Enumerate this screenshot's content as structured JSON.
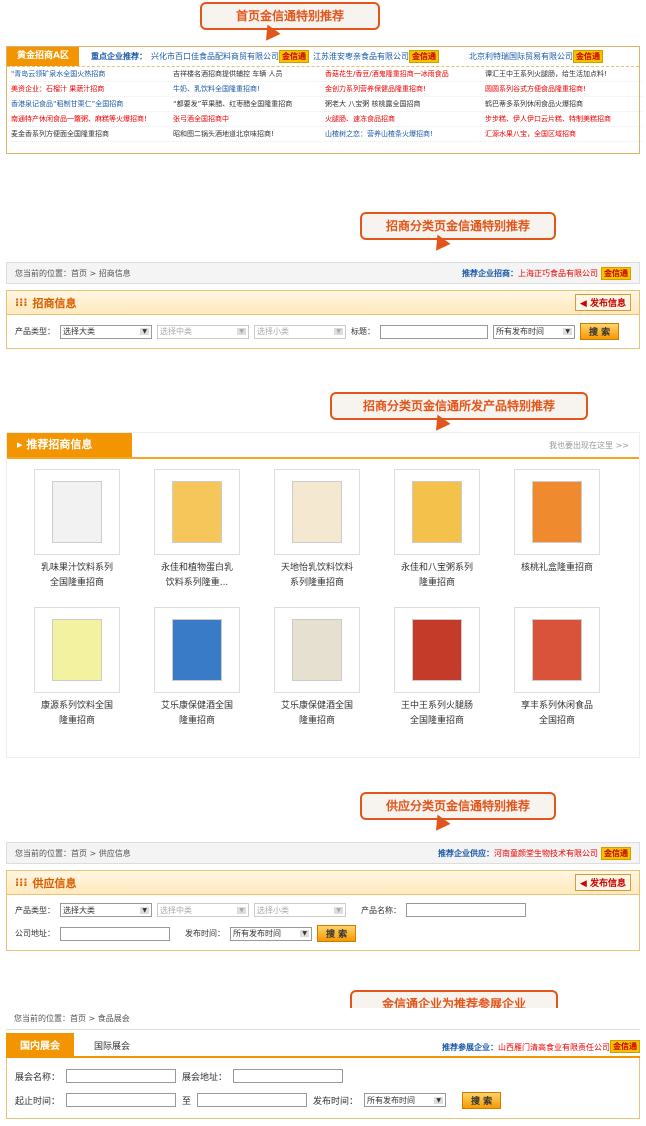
{
  "callouts": {
    "c1": "首页金信通特别推荐",
    "c2": "招商分类页金信通特别推荐",
    "c3": "招商分类页金信通所发产品特别推荐",
    "c4": "供应分类页金信通特别推荐",
    "c5": "金信通企业为推荐参展企业"
  },
  "badge": "金信通",
  "hot": "HOT",
  "home": {
    "tag": "黄金招商A区",
    "key_label": "重点企业推荐：",
    "key_items": [
      "兴化市百口佳食品配料商贸有限公司",
      "江苏淮安枣亲食品有限公司",
      "北京利特瑞国际贸易有限公司"
    ],
    "rows": [
      [
        "\"青岛云领矿泉水全国火热招商",
        "吉祥楼名酒招商提供辅控 车辆 人员",
        "香菇花生/香豆/酒鬼隆重招商一冰雨食品",
        "谭汇王中王系列火腿肠，给生活加点料!"
      ],
      [
        "美资企业：石榴汁 果蔬汁招商",
        "牛奶、乳饮料全国隆重招商!",
        "金创力系列营养保健品隆重招商!",
        "圆圆系列谷式方便食品隆重招商!"
      ],
      [
        "香港泉记食品“稻制甘栗仁”全国招商",
        "“都要发”苹果醋、红枣醋全国隆重招商",
        "粥老大 八宝粥 核桃露全国招商",
        "鹤巴蒂多系列休闲食品火爆招商"
      ],
      [
        "南通特产休闲食品一籮粥、麻糕等火爆招商!",
        "张弓酒全国招商中",
        "火腿肠、速冻食品招商",
        "步步糕、伊人伊口云片糕、特制美糕招商"
      ],
      [
        "麦金香系列方便面全国隆重招商",
        "昭和图二锅头酒地道北京味招商!",
        "山楂树之恋：营养山楂条火爆招商!",
        "汇源水果八宝，全国区域招商"
      ]
    ]
  },
  "zhaoshang": {
    "crumb": "您当前的位置：首页 > 招商信息",
    "rec_label": "推荐企业招商：",
    "rec_company": "上海正巧食品有限公司",
    "title": "招商信息",
    "publish": "发布信息",
    "type_label": "产品类型：",
    "big": "选择大类",
    "mid": "选择中类",
    "small": "选择小类",
    "kw_label": "标题：",
    "time": "所有发布时间",
    "search": "搜 索"
  },
  "recommend": {
    "title": "推荐招商信息",
    "more": "我也要出现在这里 >>",
    "products": [
      [
        "乳味果汁饮料系列",
        "全国隆重招商"
      ],
      [
        "永佳和植物蛋白乳",
        "饮料系列隆重..."
      ],
      [
        "天地怡乳饮料饮料",
        "系列隆重招商"
      ],
      [
        "永佳和八宝粥系列",
        "隆重招商"
      ],
      [
        "核桃礼盒隆重招商",
        ""
      ],
      [
        "康源系列饮料全国",
        "隆重招商"
      ],
      [
        "艾乐康保健酒全国",
        "隆重招商"
      ],
      [
        "艾乐康保健酒全国",
        "隆重招商"
      ],
      [
        "王中王系列火腿肠",
        "全国隆重招商"
      ],
      [
        "享丰系列休闲食品",
        "全国招商"
      ]
    ]
  },
  "gongying": {
    "crumb": "您当前的位置：首页 > 供应信息",
    "rec_label": "推荐企业供应：",
    "rec_company": "河南童颜堂生物技术有限公司",
    "title": "供应信息",
    "publish": "发布信息",
    "type_label": "产品类型：",
    "big": "选择大类",
    "mid": "选择中类",
    "small": "选择小类",
    "name_label": "产品名称：",
    "addr_label": "公司地址：",
    "time_label": "发布时间：",
    "time": "所有发布时间",
    "search": "搜 索"
  },
  "expo": {
    "crumb": "您当前的位置：首页 > 食品展会",
    "tab1": "国内展会",
    "tab2": "国际展会",
    "rec_label": "推荐参展企业：",
    "rec_company": "山西雁门清高食业有限责任公司",
    "name_label": "展会名称：",
    "addr_label": "展会地址：",
    "date_label": "起止时间：",
    "to": "至",
    "time_label": "发布时间：",
    "time": "所有发布时间",
    "search": "搜 索"
  }
}
